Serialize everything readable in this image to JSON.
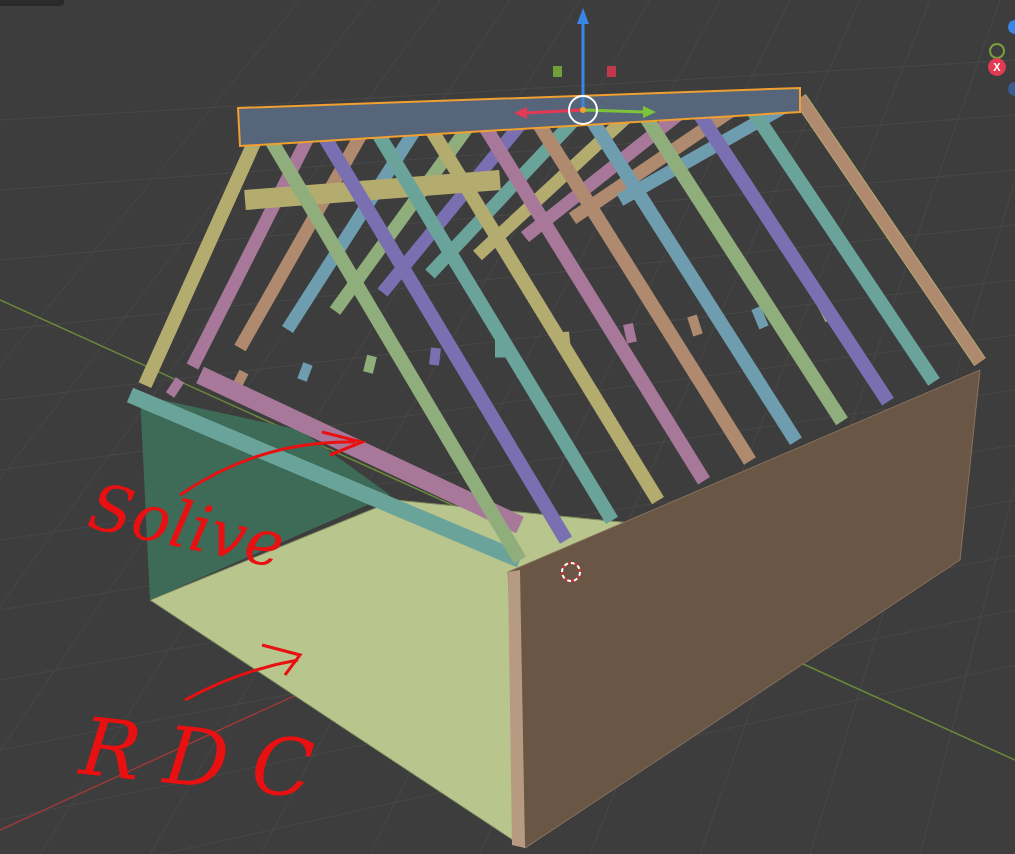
{
  "viewport": {
    "annotations": [
      {
        "text": "Solive"
      },
      {
        "text": "RDC"
      }
    ],
    "navigation_gizmo": {
      "x_label": "X"
    }
  }
}
